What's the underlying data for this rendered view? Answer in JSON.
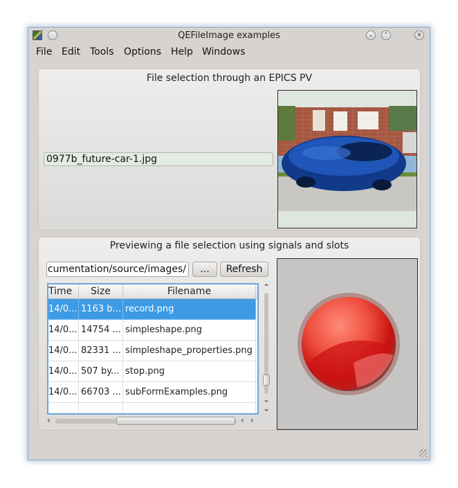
{
  "window": {
    "title": "QEFileImage examples",
    "buttons": [
      "minimize",
      "maximize",
      "close"
    ]
  },
  "menu": [
    "File",
    "Edit",
    "Tools",
    "Options",
    "Help",
    "Windows"
  ],
  "pv_group": {
    "title": "File selection through an EPICS PV",
    "filename_value": "0977b_future-car-1.jpg",
    "image_icon": "car-photo-image"
  },
  "signals_group": {
    "title": "Previewing a file selection using signals and slots",
    "path_value": "/documentation/source/images",
    "browse_label": "...",
    "refresh_label": "Refresh",
    "columns": [
      "Time",
      "Size",
      "Filename"
    ],
    "rows": [
      {
        "time": "14/0...",
        "size": "1163 b...",
        "filename": "record.png",
        "selected": true
      },
      {
        "time": "14/0...",
        "size": "14754 ...",
        "filename": "simpleshape.png",
        "selected": false
      },
      {
        "time": "14/0...",
        "size": "82331 ...",
        "filename": "simpleshape_properties.png",
        "selected": false
      },
      {
        "time": "14/0...",
        "size": "507 by...",
        "filename": "stop.png",
        "selected": false
      },
      {
        "time": "14/0...",
        "size": "66703 ...",
        "filename": "subFormExamples.png",
        "selected": false
      }
    ],
    "preview_icon": "red-record-button-image"
  },
  "colors": {
    "selection": "#3d9be6",
    "window_bg": "#d6d3d0",
    "pv_field_bg": "#e3ebe4"
  }
}
